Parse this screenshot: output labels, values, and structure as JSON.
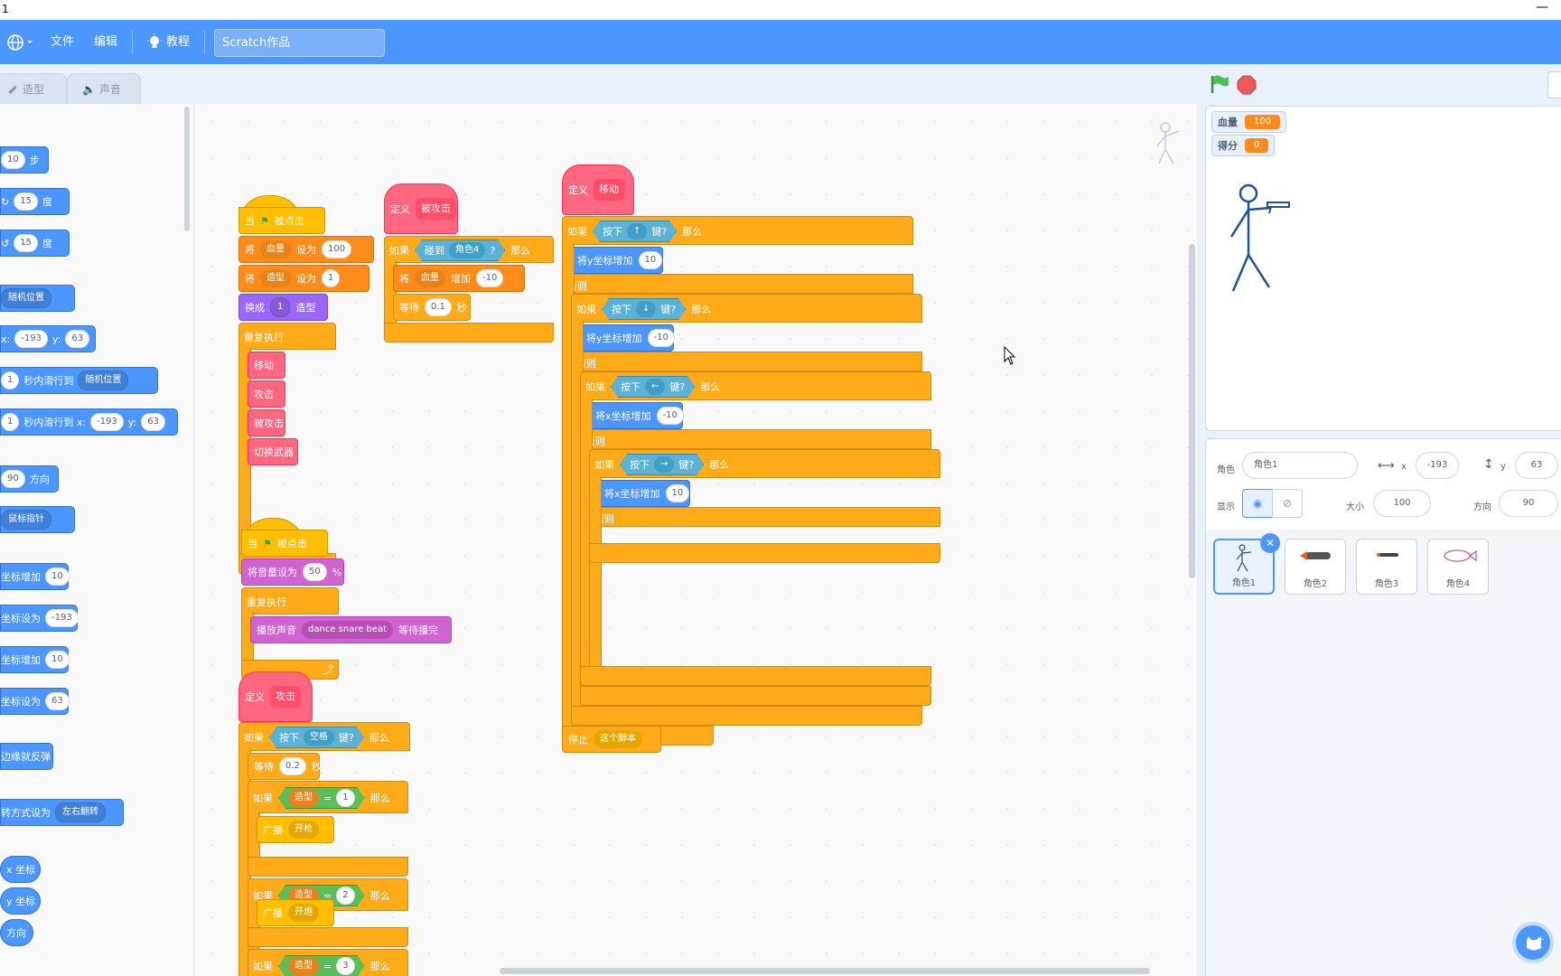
{
  "window": {
    "title": "1",
    "minimize": "—"
  },
  "menu": {
    "file": "文件",
    "edit": "编辑",
    "tutorials": "教程",
    "project_title": "Scratch作品"
  },
  "tabs": {
    "costumes": "造型",
    "sounds": "声音"
  },
  "palette": {
    "move": {
      "steps": "10",
      "label": "步"
    },
    "turn_right": {
      "deg": "15",
      "label": "度"
    },
    "turn_left": {
      "deg": "15",
      "label": "度"
    },
    "goto": {
      "target": "随机位置"
    },
    "goto_xy": {
      "x_label": "x:",
      "x": "-193",
      "y_label": "y:",
      "y": "63"
    },
    "glide": {
      "secs": "1",
      "label": "秒内滑行到",
      "target": "随机位置"
    },
    "glide_xy": {
      "secs": "1",
      "label": "秒内滑行到 x:",
      "x": "-193",
      "y_label": "y:",
      "y": "63"
    },
    "point_dir": {
      "val": "90",
      "label": "方向"
    },
    "point_to": {
      "target": "鼠标指针"
    },
    "change_x": {
      "label": "坐标增加",
      "val": "10"
    },
    "set_x": {
      "label": "坐标设为",
      "val": "-193"
    },
    "change_y": {
      "label": "坐标增加",
      "val": "10"
    },
    "set_y": {
      "label": "坐标设为",
      "val": "63"
    },
    "bounce": "边缘就反弹",
    "rotation": {
      "label": "转方式设为",
      "val": "左右翻转"
    },
    "reporters": [
      "x 坐标",
      "y 坐标",
      "方向"
    ]
  },
  "scripts": {
    "s1": {
      "hat_when": "当",
      "hat_clicked": "被点击",
      "set1_kw": "将",
      "set1_var": "血量",
      "set1_to": "设为",
      "set1_val": "100",
      "set2_kw": "将",
      "set2_var": "造型",
      "set2_to": "设为",
      "set2_val": "1",
      "switch_kw": "换成",
      "switch_val": "1",
      "switch_tail": "造型",
      "forever": "重复执行",
      "calls": [
        "移动",
        "攻击",
        "被攻击",
        "切换武器"
      ],
      "loop_arrow": "⤴"
    },
    "s2": {
      "define": "定义",
      "name": "被攻击",
      "if": "如果",
      "touch": "碰到",
      "touch_target": "角色4",
      "q": "?",
      "then": "那么",
      "change_kw": "将",
      "change_var": "血量",
      "change_by": "增加",
      "change_val": "-10",
      "wait": "等待",
      "wait_val": "0.1",
      "secs": "秒"
    },
    "s3": {
      "define": "定义",
      "name": "移动",
      "if1": "如果",
      "press1": "按下",
      "key1": "↑",
      "key_q1": "键?",
      "then1": "那么",
      "act1": "将y坐标增加",
      "act1_val": "10",
      "else1": "否则",
      "if2": "如果",
      "press2": "按下",
      "key2": "↓",
      "key_q2": "键?",
      "then2": "那么",
      "act2": "将y坐标增加",
      "act2_val": "-10",
      "else2": "否则",
      "if3": "如果",
      "press3": "按下",
      "key3": "←",
      "key_q3": "键?",
      "then3": "那么",
      "act3": "将x坐标增加",
      "act3_val": "-10",
      "else3": "否则",
      "if4": "如果",
      "press4": "按下",
      "key4": "→",
      "key_q4": "键?",
      "then4": "那么",
      "act4": "将x坐标增加",
      "act4_val": "10",
      "else4": "否则",
      "stop": "停止",
      "stop_val": "这个脚本"
    },
    "s4": {
      "hat_when": "当",
      "hat_clicked": "被点击",
      "vol": "将音量设为",
      "vol_val": "50",
      "vol_unit": "%",
      "forever": "重复执行",
      "play": "播放声音",
      "sound": "dance snare beat",
      "play_tail": "等待播完",
      "loop_arrow": "⤴"
    },
    "s5": {
      "define": "定义",
      "name": "攻击",
      "if": "如果",
      "press": "按下",
      "key": "空格",
      "key_q": "键?",
      "then": "那么",
      "wait": "等待",
      "wait_val": "0.2",
      "secs": "秒",
      "c1_if": "如果",
      "c1_var": "造型",
      "c1_eq": "=",
      "c1_val": "1",
      "c1_then": "那么",
      "c1_bc": "广播",
      "c1_msg": "开枪",
      "c2_if": "如果",
      "c2_var": "造型",
      "c2_eq": "=",
      "c2_val": "2",
      "c2_then": "那么",
      "c2_bc": "广播",
      "c2_msg": "开炮",
      "c3_if": "如果",
      "c3_var": "造型",
      "c3_eq": "=",
      "c3_val": "3",
      "c3_then": "那么"
    }
  },
  "stage": {
    "monitors": [
      {
        "label": "血量",
        "value": "100"
      },
      {
        "label": "得分",
        "value": "0"
      }
    ]
  },
  "sprite_info": {
    "sprite_label": "角色",
    "sprite_name": "角色1",
    "x_label": "x",
    "x": "-193",
    "y_label": "y",
    "y": "63",
    "show_label": "显示",
    "size_label": "大小",
    "size": "100",
    "dir_label": "方向",
    "dir": "90"
  },
  "sprites": [
    {
      "name": "角色1"
    },
    {
      "name": "角色2"
    },
    {
      "name": "角色3"
    },
    {
      "name": "角色4"
    }
  ],
  "colors": {
    "menu": "#4c97ff",
    "events": "#ffbf00",
    "control": "#ffab19",
    "variables": "#ff8c1a",
    "myblocks": "#ff6680",
    "sensing": "#5cb1d6",
    "operators": "#59c059",
    "looks": "#9966ff",
    "sound": "#cf63cf",
    "motion": "#4c97ff"
  },
  "zoom_buttons": {
    "in": "⊕",
    "out": "⊖",
    "reset": "="
  }
}
